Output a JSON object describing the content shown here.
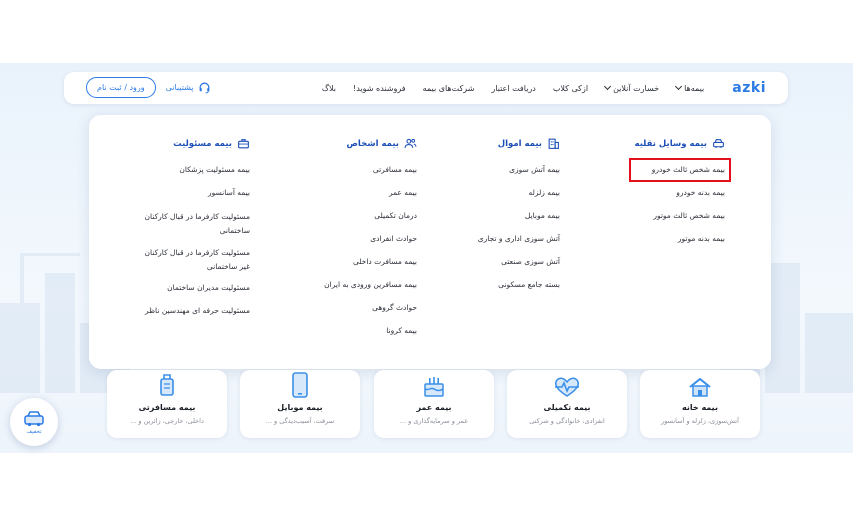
{
  "header": {
    "logo": "azki",
    "nav": [
      {
        "label": "بیمه‌ها",
        "dropdown": true
      },
      {
        "label": "خسارت آنلاین",
        "dropdown": true
      },
      {
        "label": "ازکی کلاب",
        "dropdown": false
      },
      {
        "label": "دریافت اعتبار",
        "dropdown": false
      },
      {
        "label": "شرکت‌های بیمه",
        "dropdown": false
      },
      {
        "label": "فروشنده شوید!",
        "dropdown": false
      },
      {
        "label": "بلاگ",
        "dropdown": false
      }
    ],
    "support_label": "پشتیبانی",
    "login_label": "ورود / ثبت نام"
  },
  "mega_menu": {
    "vehicle": {
      "title": "بیمه وسایل نقلیه",
      "items": [
        "بیمه شخص ثالث خودرو",
        "بیمه بدنه خودرو",
        "بیمه شخص ثالث موتور",
        "بیمه بدنه موتور"
      ],
      "highlighted_item": "بیمه شخص ثالث خودرو"
    },
    "property": {
      "title": "بیمه اموال",
      "items": [
        "بیمه آتش سوزی",
        "بیمه زلزله",
        "بیمه موبایل",
        "آتش سوزی اداری و تجاری",
        "آتش سوزی صنعتی",
        "بسته جامع مسکونی"
      ]
    },
    "persons": {
      "title": "بیمه اشخاص",
      "items": [
        "بیمه مسافرتی",
        "بیمه عمر",
        "درمان تکمیلی",
        "حوادث انفرادی",
        "بیمه مسافرت داخلی",
        "بیمه مسافرین ورودی به ایران",
        "حوادث گروهی",
        "بیمه کرونا"
      ]
    },
    "liability": {
      "title": "بیمه مسئولیت",
      "items": [
        "بیمه مسئولیت پزشکان",
        "بیمه آسانسور",
        "مسئولیت کارفرما در قبال کارکنان ساختمانی",
        "مسئولیت کارفرما در قبال کارکنان غیر ساختمانی",
        "مسئولیت مدیران ساختمان",
        "مسئولیت حرفه ای مهندسین ناظر"
      ]
    }
  },
  "cards": [
    {
      "title": "بیمه خانه",
      "subtitle": "آتش‌سوزی، زلزله و آسانسور",
      "icon": "house-icon"
    },
    {
      "title": "بیمه تکمیلی",
      "subtitle": "انفرادی، خانوادگی و شرکتی",
      "icon": "heart-pulse-icon"
    },
    {
      "title": "بیمه عمر",
      "subtitle": "عمر و سرمایه‌گذاری و ...",
      "icon": "cake-icon"
    },
    {
      "title": "بیمه موبایل",
      "subtitle": "سرقت، آسیب‌دیدگی و ...",
      "icon": "phone-icon"
    },
    {
      "title": "بیمه مسافرتی",
      "subtitle": "داخلی، خارجی، زائرین و ...",
      "icon": "luggage-icon"
    }
  ],
  "fab_label": "تخفیف",
  "colors": {
    "accent": "#2c7be5",
    "title": "#1d4fb8",
    "highlight": "#e3111b"
  }
}
